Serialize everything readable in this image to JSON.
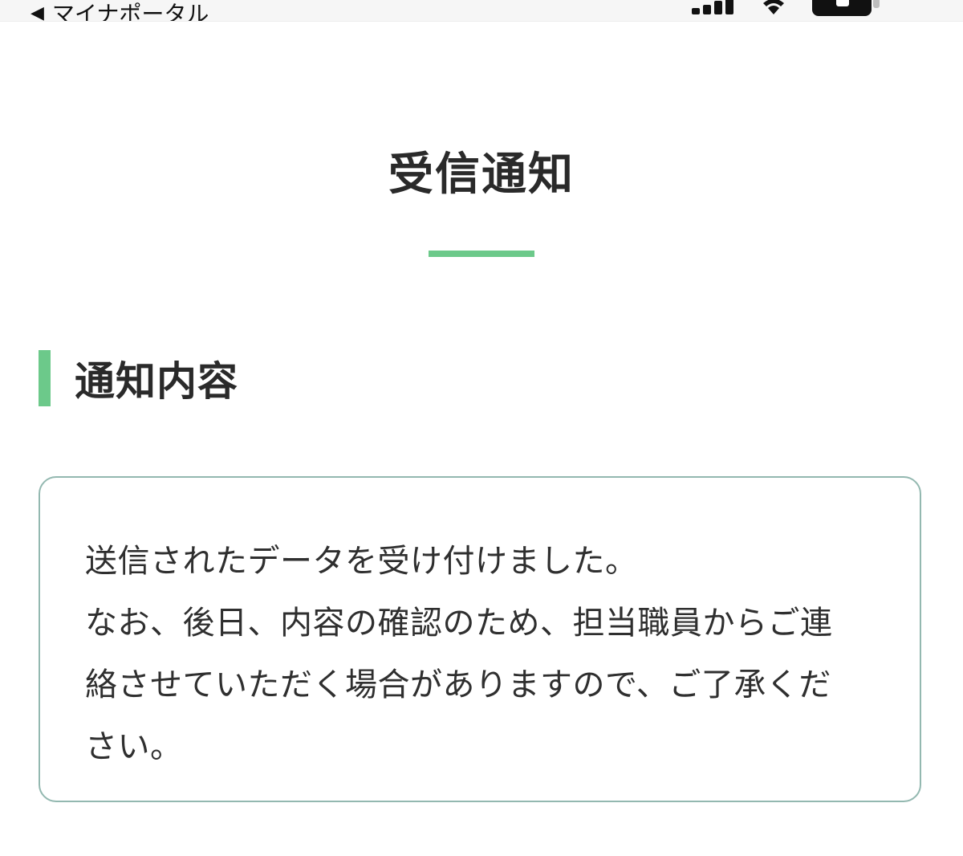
{
  "status_bar": {
    "back_label": "マイナポータル",
    "back_icon": "back-triangle-icon",
    "signal_icon": "cellular-signal-icon",
    "wifi_icon": "wifi-icon",
    "battery_icon": "battery-icon"
  },
  "page": {
    "title": "受信通知",
    "accent_color": "#6cc98a",
    "border_color": "#93b8b0"
  },
  "section": {
    "heading": "通知内容"
  },
  "notice": {
    "lines": [
      "送信されたデータを受け付けました。",
      "なお、後日、内容の確認のため、担当職員からご連",
      "絡させていただく場合がありますので、ご了承くだ",
      "さい。"
    ]
  }
}
